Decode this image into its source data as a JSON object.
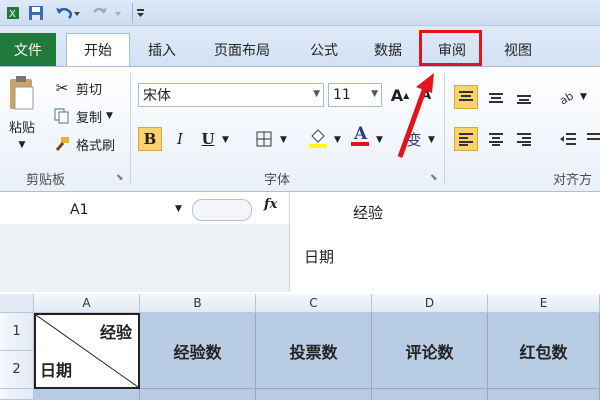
{
  "quick_access": {
    "save_icon": "save-icon",
    "undo_icon": "undo-icon",
    "redo_icon": "redo-icon",
    "customize_icon": "customize-qat-icon"
  },
  "tabs": {
    "file": "文件",
    "items": [
      "开始",
      "插入",
      "页面布局",
      "公式",
      "数据",
      "审阅",
      "视图"
    ],
    "active": "开始",
    "highlighted": "审阅"
  },
  "ribbon": {
    "clipboard": {
      "paste": "粘贴",
      "cut": "剪切",
      "copy": "复制",
      "format_painter": "格式刷",
      "group_label": "剪贴板"
    },
    "font": {
      "font_name": "宋体",
      "font_size": "11",
      "bold": "B",
      "italic": "I",
      "underline": "U",
      "group_label": "字体",
      "phonetic": "变"
    },
    "alignment": {
      "group_label": "对齐方"
    }
  },
  "formula_bar": {
    "name_box": "A1",
    "fx": "fx",
    "line1": "经验",
    "line2": "日期"
  },
  "grid": {
    "columns": [
      "A",
      "B",
      "C",
      "D",
      "E"
    ],
    "rows": [
      "1",
      "2"
    ],
    "a1_top": "经验",
    "a1_bottom": "日期",
    "headers": [
      "经验数",
      "投票数",
      "评论数",
      "红包数"
    ]
  },
  "colors": {
    "file_tab": "#1f7a3c",
    "highlight": "#e3141c",
    "header_fill": "#b8cce4"
  }
}
